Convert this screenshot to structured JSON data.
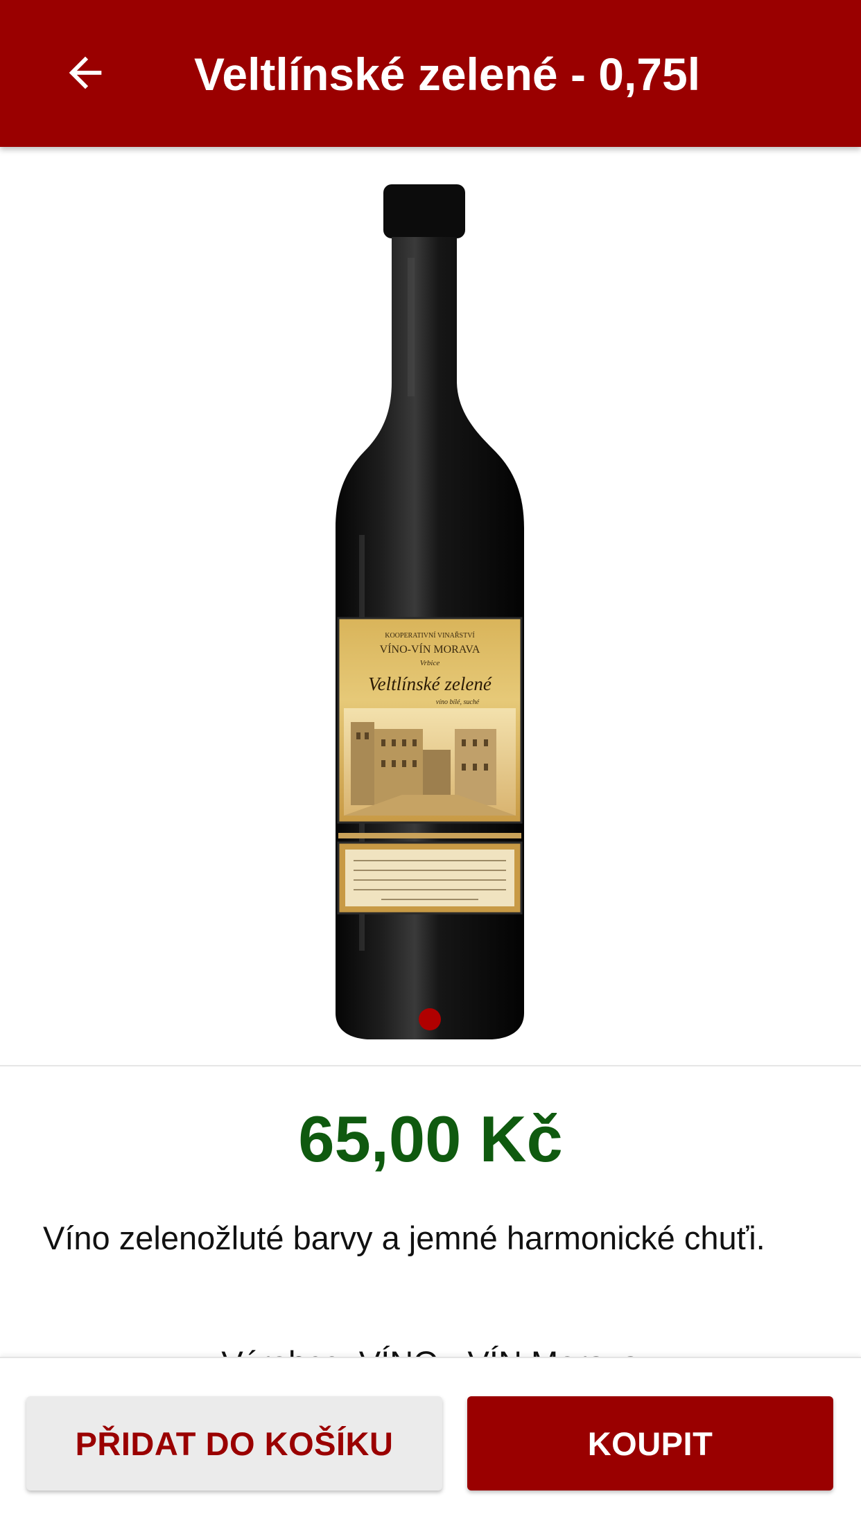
{
  "appbar": {
    "title": "Veltlínské zelené - 0,75l",
    "back_icon": "arrow-left-icon"
  },
  "carousel": {
    "label": {
      "top_line": "KOOPERATIVNÍ VINAŘSTVÍ",
      "brand": "VÍNO-VÍN MORAVA",
      "origin": "Vrbice",
      "wine_name": "Veltlínské zelené",
      "wine_type": "víno bílé, suché"
    },
    "active_page": 1,
    "page_count": 1
  },
  "product": {
    "price": "65,00 Kč",
    "description": "Víno zelenožluté barvy a jemné harmonické chuťi.",
    "producer": "Výrobce: VÍNO - VÍN Morava"
  },
  "actions": {
    "add_to_cart_label": "PŘIDAT DO KOŠÍKU",
    "buy_label": "KOUPIT"
  },
  "colors": {
    "primary": "#9a0000",
    "price": "#0f5a0f",
    "page_indicator": "#b00000"
  }
}
